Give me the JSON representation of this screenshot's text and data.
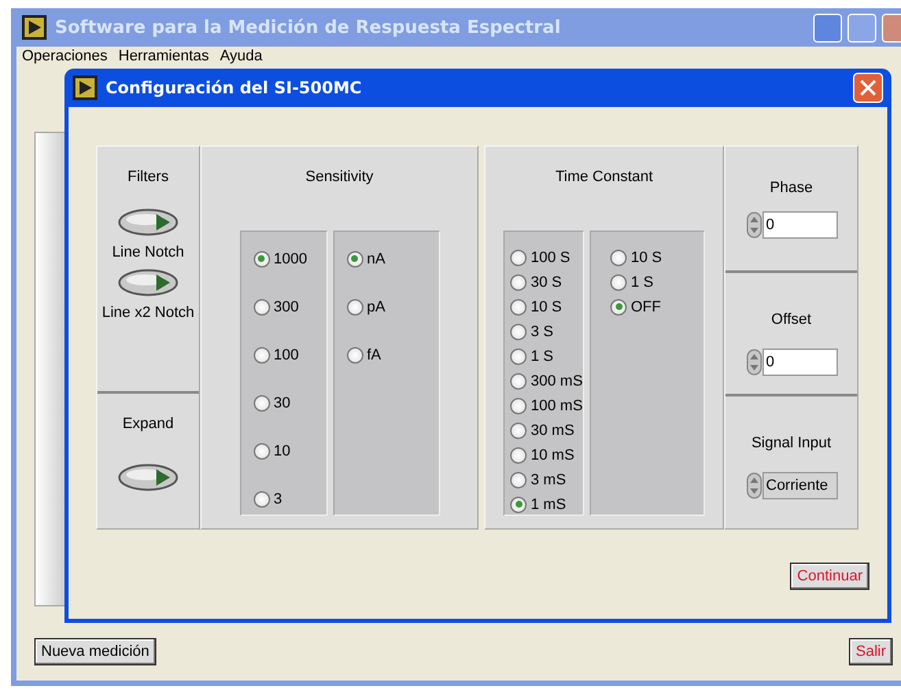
{
  "main_window": {
    "title": "Software para la Medición de Respuesta Espectral",
    "active": false
  },
  "menu": [
    "Operaciones",
    "Herramientas",
    "Ayuda"
  ],
  "dialog": {
    "title": "Configuración del SI-500MC",
    "filters": {
      "title": "Filters",
      "toggles": [
        {
          "label": "Line Notch",
          "on": false
        },
        {
          "label": "Line x2 Notch",
          "on": false
        }
      ]
    },
    "expand": {
      "title": "Expand",
      "on": false
    },
    "sensitivity": {
      "title": "Sensitivity",
      "values": [
        {
          "label": "1000",
          "selected": true
        },
        {
          "label": "300",
          "selected": false
        },
        {
          "label": "100",
          "selected": false
        },
        {
          "label": "30",
          "selected": false
        },
        {
          "label": "10",
          "selected": false
        },
        {
          "label": "3",
          "selected": false
        }
      ],
      "units": [
        {
          "label": "nA",
          "selected": true
        },
        {
          "label": "pA",
          "selected": false
        },
        {
          "label": "fA",
          "selected": false
        }
      ]
    },
    "time_constant": {
      "title": "Time Constant",
      "values": [
        {
          "label": "100 S",
          "selected": false
        },
        {
          "label": "30 S",
          "selected": false
        },
        {
          "label": "10 S",
          "selected": false
        },
        {
          "label": "3 S",
          "selected": false
        },
        {
          "label": "1 S",
          "selected": false
        },
        {
          "label": "300 mS",
          "selected": false
        },
        {
          "label": "100 mS",
          "selected": false
        },
        {
          "label": "30 mS",
          "selected": false
        },
        {
          "label": "10 mS",
          "selected": false
        },
        {
          "label": "3 mS",
          "selected": false
        },
        {
          "label": "1 mS",
          "selected": true
        }
      ],
      "extra": [
        {
          "label": "10 S",
          "selected": false
        },
        {
          "label": "1 S",
          "selected": false
        },
        {
          "label": "OFF",
          "selected": true
        }
      ]
    },
    "phase": {
      "title": "Phase",
      "value": "0"
    },
    "offset": {
      "title": "Offset",
      "value": "0"
    },
    "signal_input": {
      "title": "Signal Input",
      "value": "Corriente"
    },
    "continue_button": "Continuar"
  },
  "new_button": "Nueva medición",
  "exit_button": "Salir"
}
